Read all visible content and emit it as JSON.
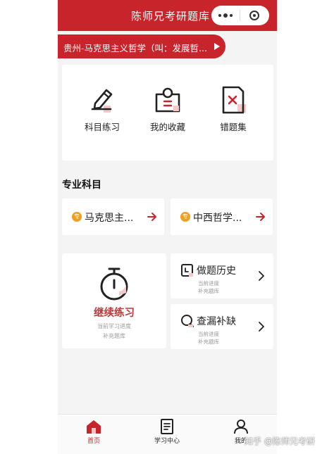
{
  "header": {
    "title": "陈师兄考研题库"
  },
  "notice": {
    "text": "贵州-马克思主义哲学（叫：发展哲..."
  },
  "quick_actions": [
    {
      "label": "科目练习",
      "icon": "pencil-edit-icon"
    },
    {
      "label": "我的收藏",
      "icon": "collection-box-icon"
    },
    {
      "label": "错题集",
      "icon": "wrong-question-icon"
    }
  ],
  "section": {
    "title": "专业科目"
  },
  "subjects": [
    {
      "badge": "专",
      "name": "马克思主..."
    },
    {
      "badge": "专",
      "name": "中西哲学..."
    }
  ],
  "continue": {
    "title": "继续练习",
    "subtitle1": "当前学习进度",
    "subtitle2": "补充题库"
  },
  "history": {
    "title": "做题历史",
    "subtitle1": "当前进度",
    "subtitle2": "补充题库"
  },
  "review": {
    "title": "查漏补缺",
    "subtitle1": "当前进度",
    "subtitle2": "补充题库"
  },
  "tabbar": [
    {
      "label": "首页",
      "active": true
    },
    {
      "label": "学习中心",
      "active": false
    },
    {
      "label": "我的",
      "active": false
    }
  ],
  "watermark": {
    "text": "知乎 @陈师兄考研"
  },
  "colors": {
    "brand": "#c8242c",
    "accent_text": "#b83a3a",
    "badge": "#f0a020",
    "page_bg": "#f4f4f4"
  }
}
